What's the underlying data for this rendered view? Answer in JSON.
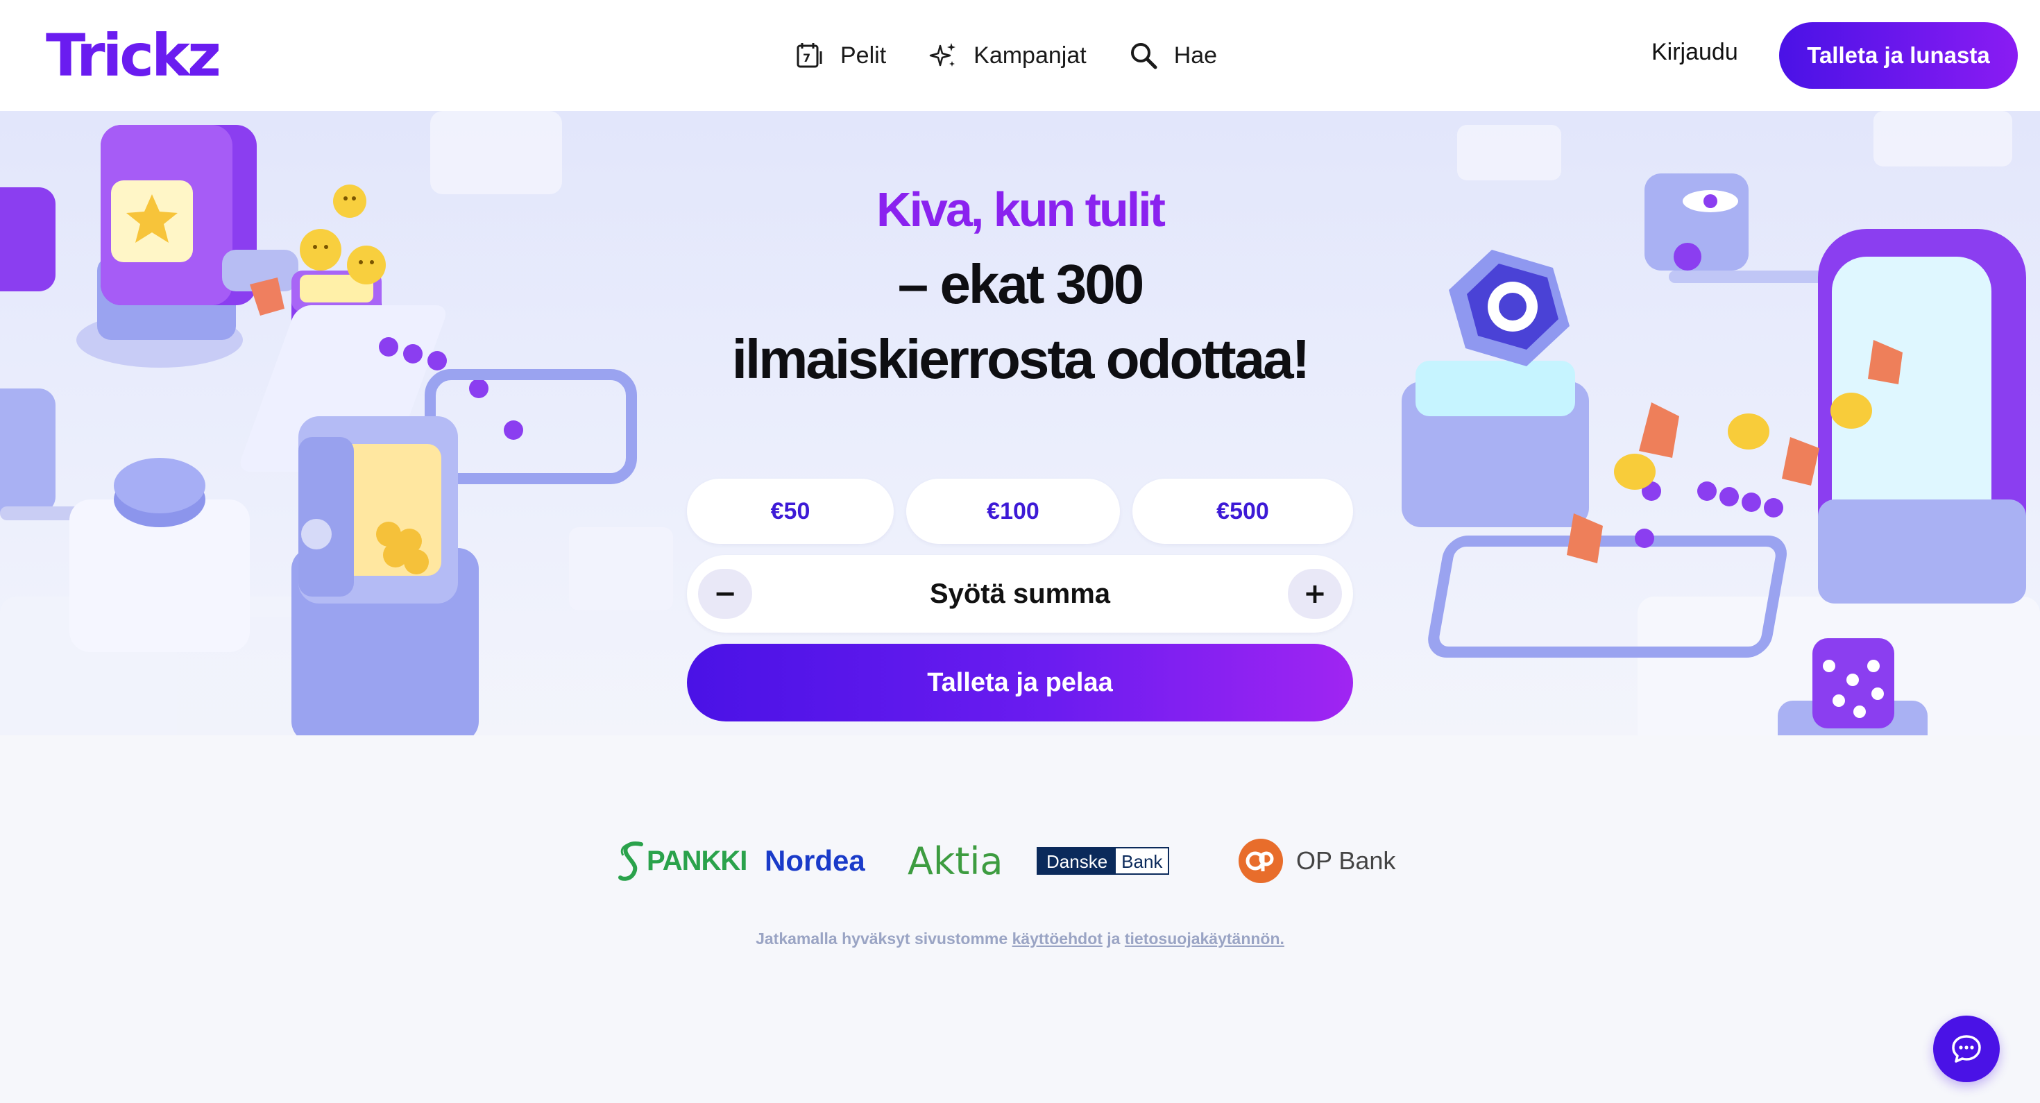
{
  "header": {
    "logo": "Trickz",
    "nav": [
      {
        "label": "Pelit",
        "icon": "calendar-7-icon"
      },
      {
        "label": "Kampanjat",
        "icon": "sparkles-icon"
      },
      {
        "label": "Hae",
        "icon": "search-icon"
      }
    ],
    "login_label": "Kirjaudu",
    "cta_label": "Talleta ja lunasta"
  },
  "hero": {
    "headline_accent": "Kiva, kun tulit",
    "headline_line2": "– ekat 300",
    "headline_line3": "ilmaiskierrosta odottaa!"
  },
  "deposit": {
    "amounts": [
      "€50",
      "€100",
      "€500"
    ],
    "input_label": "Syötä summa",
    "minus": "−",
    "plus": "+",
    "submit_label": "Talleta ja pelaa"
  },
  "banks": {
    "spankki": "PANKKI",
    "nordea": "Nordea",
    "aktia": "Aktia",
    "danske_1": "Danske",
    "danske_2": "Bank",
    "op": "OP Bank"
  },
  "legal": {
    "prefix": "Jatkamalla hyväksyt sivustomme",
    "terms_link": "käyttöehdot",
    "middle": "ja",
    "privacy_link": "tietosuojakäytännön."
  },
  "colors": {
    "brand": "#4a12e6",
    "accent": "#8a22ef",
    "amount_text": "#3d1ad6"
  },
  "chat_icon": "chat-bubble-icon"
}
